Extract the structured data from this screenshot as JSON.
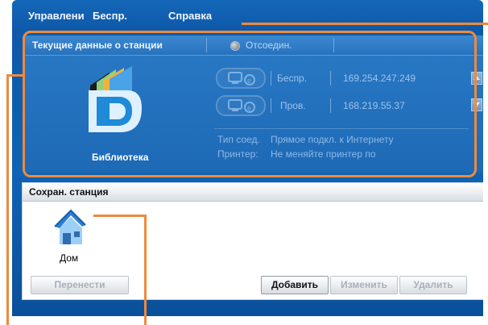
{
  "menu": {
    "items": [
      "Управлени",
      "Беспр.",
      "Справка"
    ]
  },
  "station": {
    "title": "Текущие данные о станции",
    "status": "Отсоедин.",
    "icon_label": "Библиотека",
    "wireless": {
      "label": "Беспр.",
      "ip": "169.254.247.249"
    },
    "wired": {
      "label": "Пров.",
      "ip": "168.219.55.37"
    },
    "conn_type_key": "Тип соед.",
    "conn_type_value": "Прямое подкл. к Интернету",
    "printer_key": "Принтер:",
    "printer_value": "Не меняйте принтер по"
  },
  "saved": {
    "title": "Сохран. станция",
    "home_label": "Дом",
    "buttons": {
      "move": "Перенести",
      "add": "Добавить",
      "edit": "Изменить",
      "delete": "Удалить"
    }
  },
  "colors": {
    "window_blue": "#0f63b4",
    "annotation_orange": "#ee8a3b"
  }
}
